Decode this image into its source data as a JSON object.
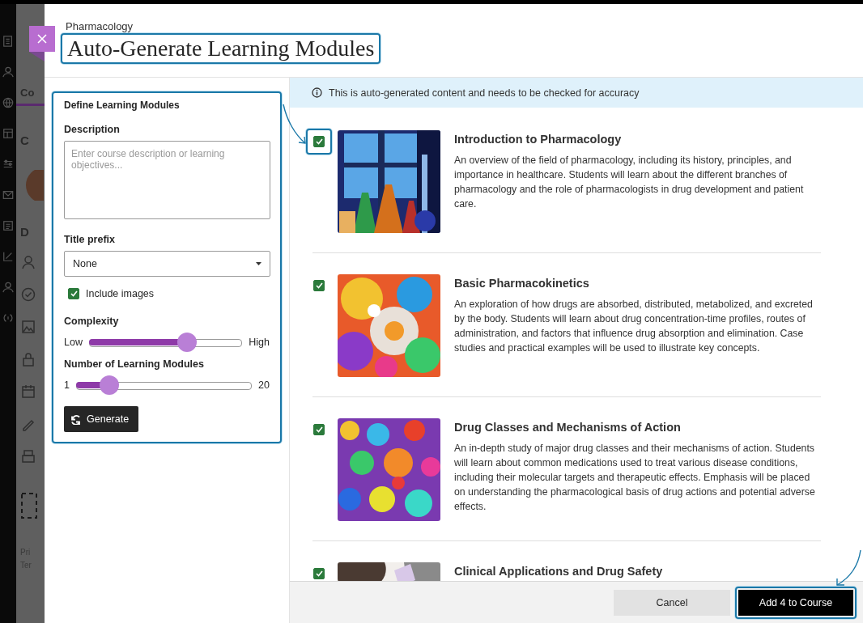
{
  "background": {
    "tab": "Co",
    "heading": "C",
    "section": "D",
    "footer_lines": [
      "Pri",
      "Ter"
    ]
  },
  "modal": {
    "course": "Pharmacology",
    "title": "Auto-Generate Learning Modules",
    "title_highlighted": true
  },
  "form": {
    "heading": "Define Learning Modules",
    "highlighted": true,
    "description": {
      "label": "Description",
      "placeholder": "Enter course description or learning objectives..."
    },
    "title_prefix": {
      "label": "Title prefix",
      "value": "None"
    },
    "include_images": {
      "label": "Include images",
      "checked": true
    },
    "complexity": {
      "label": "Complexity",
      "min_label": "Low",
      "max_label": "High",
      "level": 0.66
    },
    "module_count": {
      "label": "Number of Learning Modules",
      "min_label": "1",
      "max_label": "20",
      "level": 0.15
    },
    "generate_button": "Generate"
  },
  "notice": "This is auto-generated content and needs to be checked for accuracy",
  "modules": [
    {
      "title": "Introduction to Pharmacology",
      "description": "An overview of the field of pharmacology, including its history, principles, and importance in healthcare. Students will learn about the different branches of pharmacology and the role of pharmacologists in drug development and patient care.",
      "checked": true,
      "highlighted": true
    },
    {
      "title": "Basic Pharmacokinetics",
      "description": "An exploration of how drugs are absorbed, distributed, metabolized, and excreted by the body. Students will learn about drug concentration-time profiles, routes of administration, and factors that influence drug absorption and elimination. Case studies and practical examples will be used to illustrate key concepts.",
      "checked": true,
      "highlighted": false
    },
    {
      "title": "Drug Classes and Mechanisms of Action",
      "description": "An in-depth study of major drug classes and their mechanisms of action. Students will learn about common medications used to treat various disease conditions, including their molecular targets and therapeutic effects. Emphasis will be placed on understanding the pharmacological basis of drug actions and potential adverse effects.",
      "checked": true,
      "highlighted": false
    },
    {
      "title": "Clinical Applications and Drug Safety",
      "checked": true,
      "highlighted": false
    }
  ],
  "footer": {
    "cancel": "Cancel",
    "add": "Add 4 to Course",
    "add_highlighted": true
  }
}
